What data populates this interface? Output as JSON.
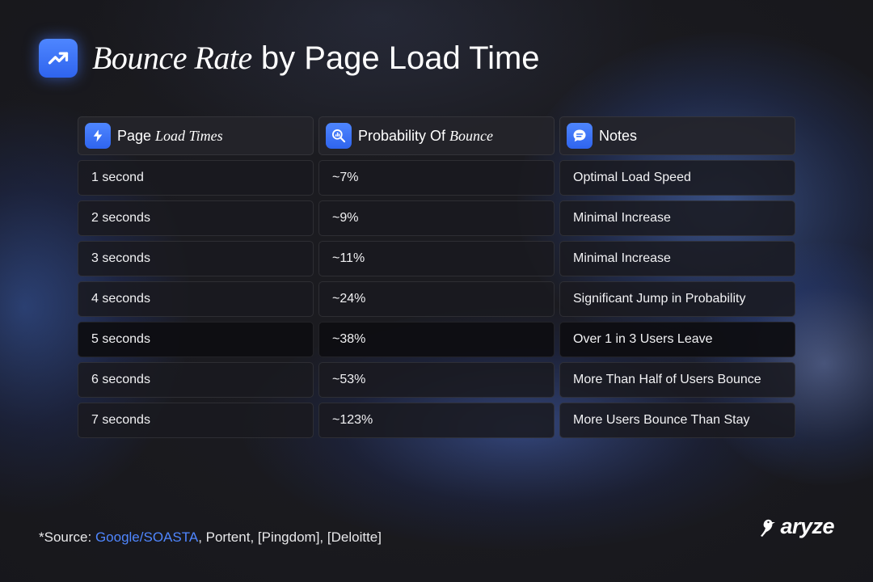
{
  "header": {
    "title_italic": "Bounce Rate",
    "title_rest": " by Page Load Time",
    "icon": "trending-up-icon"
  },
  "chart_data": {
    "type": "table",
    "columns": [
      {
        "label_plain": "Page ",
        "label_italic": "Load Times",
        "icon": "lightning-bolt-icon"
      },
      {
        "label_plain": "Probability Of ",
        "label_italic": "Bounce",
        "icon": "magnify-chart-icon"
      },
      {
        "label_plain": "Notes",
        "label_italic": "",
        "icon": "chat-bubble-icon"
      }
    ],
    "rows": [
      {
        "load_time": "1 second",
        "probability": "~7%",
        "note": "Optimal Load Speed"
      },
      {
        "load_time": "2 seconds",
        "probability": "~9%",
        "note": "Minimal Increase"
      },
      {
        "load_time": "3  seconds",
        "probability": "~11%",
        "note": "Minimal Increase"
      },
      {
        "load_time": "4  seconds",
        "probability": "~24%",
        "note": "Significant Jump in Probability"
      },
      {
        "load_time": "5 seconds",
        "probability": "~38%",
        "note": "Over 1 in 3 Users Leave"
      },
      {
        "load_time": "6 seconds",
        "probability": "~53%",
        "note": "More Than Half of Users Bounce"
      },
      {
        "load_time": "7 seconds",
        "probability": "~123%",
        "note": "More Users Bounce Than Stay"
      }
    ]
  },
  "footer": {
    "prefix": "*Source: ",
    "link": "Google/SOASTA",
    "rest": ", Portent, [Pingdom], [Deloitte]"
  },
  "brand": {
    "name": "aryze",
    "icon": "bird-logo-icon"
  },
  "colors": {
    "accent": "#3e78f6",
    "link": "#4f86ff",
    "background": "#1b1b20"
  }
}
